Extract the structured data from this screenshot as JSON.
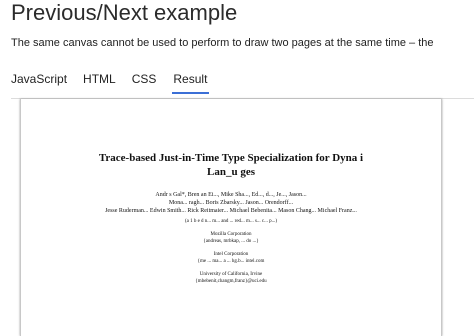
{
  "header": {
    "title": "Previous/Next example",
    "intro": "The same canvas cannot be used to perform to draw two pages at the same time – the"
  },
  "tabs": [
    {
      "label": "JavaScript",
      "active": false
    },
    {
      "label": "HTML",
      "active": false
    },
    {
      "label": "CSS",
      "active": false
    },
    {
      "label": "Result",
      "active": true
    }
  ],
  "result": {
    "paper_title_line1": "Trace-based Just-in-Time Type Specialization for Dyna i",
    "paper_title_line2": "Lan_u ges",
    "authors": [
      "Andr s Gal*, Bren an Ei..., Mike Sha..., Ed..., d..., Je..., Jason...",
      "Mona... ragh... Boris Zbarsky... Jason... Orendorff...",
      "Jesse Ruderman... Edwin Smith... Rick Reitmaier... Michael Bebenita... Mason Chang... Michael Franz..."
    ],
    "affiliation_1": "(a 1 b e d n... m... and ... red... m... s... c... p...)",
    "affiliation_2": "Mozilla Corporation",
    "affiliation_3": "{andreas, mrbkap, ... do ...}",
    "affiliation_4": "Intel Corporation",
    "affiliation_5": "{me ... ma... a ... hg.b... intel.com",
    "affiliation_6": "University of California, Irvine",
    "affiliation_7": "{mbebenit,changm,franz}@uci.edu"
  }
}
